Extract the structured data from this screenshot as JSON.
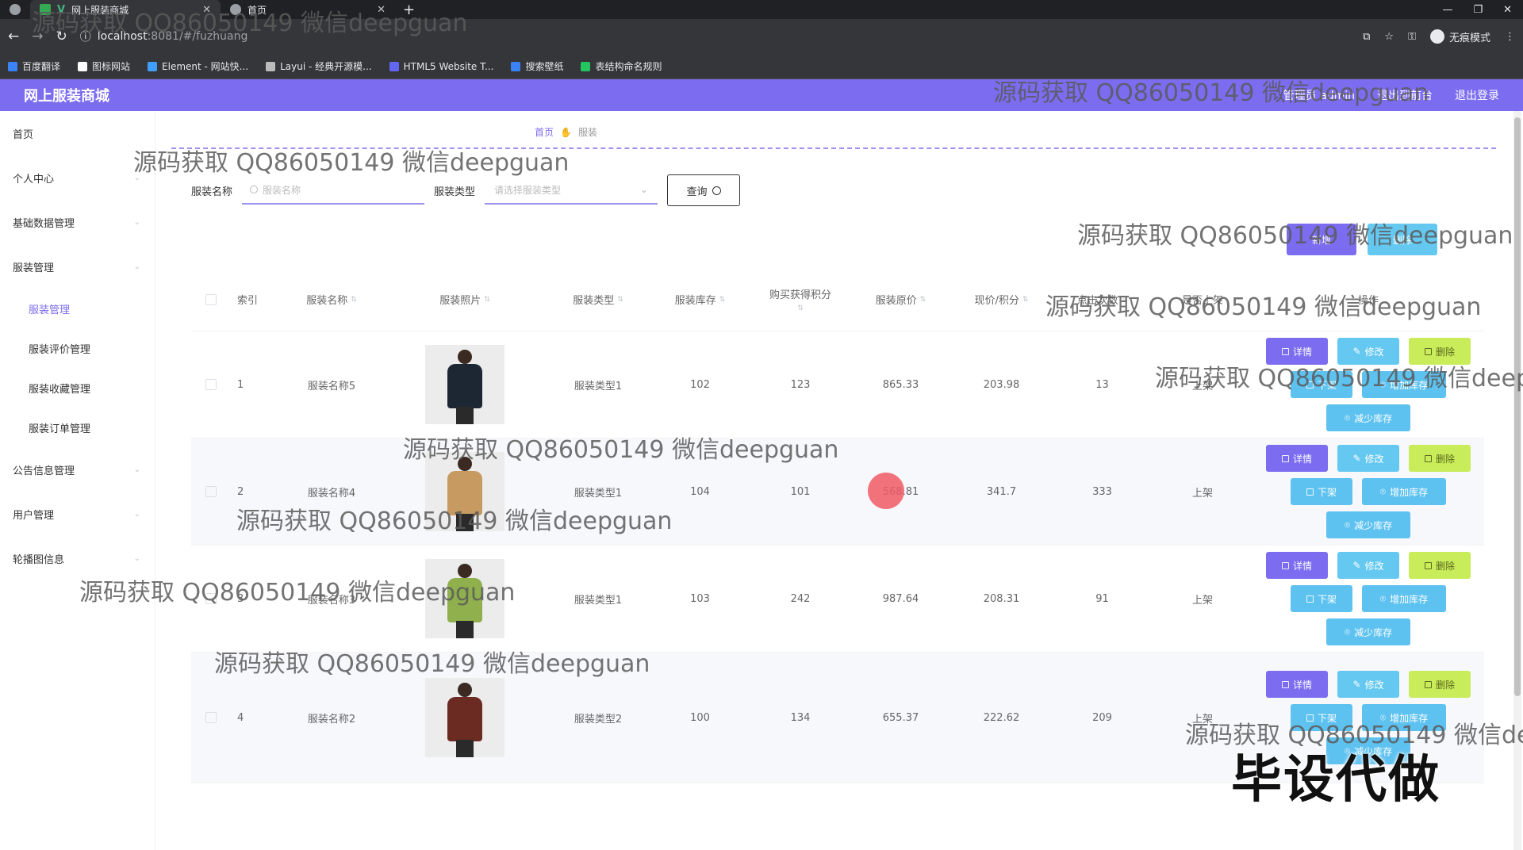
{
  "browser": {
    "tabs": [
      {
        "label": "网上服装商城",
        "active": true
      },
      {
        "label": "首页",
        "active": false
      }
    ],
    "url_host": "localhost",
    "url_rest": ":8081/#/fuzhuang",
    "incognito_label": "无痕模式",
    "bookmarks": [
      {
        "label": "百度翻译",
        "color": "#3b82f6"
      },
      {
        "label": "图标网站",
        "color": "#ffffff"
      },
      {
        "label": "Element - 网站快...",
        "color": "#409eff"
      },
      {
        "label": "Layui - 经典开源模...",
        "color": "#bbbbbb"
      },
      {
        "label": "HTML5 Website T...",
        "color": "#6366f1"
      },
      {
        "label": "搜索壁纸",
        "color": "#3b82f6"
      },
      {
        "label": "表结构命名规则",
        "color": "#22c55e"
      }
    ]
  },
  "header": {
    "title": "网上服装商城",
    "user": "管理员 admin",
    "exit_system": "退出到前台",
    "logout": "退出登录",
    "bg_color": "#7b6cf0"
  },
  "sidebar": {
    "items": [
      {
        "label": "首页",
        "expandable": false
      },
      {
        "label": "个人中心",
        "expandable": true
      },
      {
        "label": "基础数据管理",
        "expandable": true
      },
      {
        "label": "服装管理",
        "expandable": true
      }
    ],
    "sub_items": [
      {
        "label": "服装管理",
        "active": true
      },
      {
        "label": "服装评价管理",
        "active": false
      },
      {
        "label": "服装收藏管理",
        "active": false
      },
      {
        "label": "服装订单管理",
        "active": false
      }
    ],
    "items_after": [
      {
        "label": "公告信息管理",
        "expandable": true
      },
      {
        "label": "用户管理",
        "expandable": true
      },
      {
        "label": "轮播图信息",
        "expandable": true
      }
    ]
  },
  "breadcrumb": {
    "home": "首页",
    "current": "服装"
  },
  "search": {
    "name_label": "服装名称",
    "name_placeholder": "服装名称",
    "type_label": "服装类型",
    "type_placeholder": "请选择服装类型",
    "query_button": "查询"
  },
  "toolbar": {
    "add_label": "新增",
    "delete_label": "删除"
  },
  "table": {
    "columns": {
      "index": "索引",
      "name": "服装名称",
      "photo": "服装照片",
      "type": "服装类型",
      "stock": "服装库存",
      "points": "购买获得积分",
      "orig_price": "服装原价",
      "now_price": "现价/积分",
      "clicks": "点击次数",
      "status": "是否上架",
      "ops": "操作"
    },
    "rows": [
      {
        "index": "1",
        "name": "服装名称5",
        "type": "服装类型1",
        "stock": "102",
        "points": "123",
        "orig_price": "865.33",
        "now_price": "203.98",
        "clicks": "13",
        "status": "上架",
        "photo_color": "#1c2733"
      },
      {
        "index": "2",
        "name": "服装名称4",
        "type": "服装类型1",
        "stock": "104",
        "points": "101",
        "orig_price": "568.81",
        "now_price": "341.7",
        "clicks": "333",
        "status": "上架",
        "photo_color": "#c79a62"
      },
      {
        "index": "3",
        "name": "服装名称3",
        "type": "服装类型1",
        "stock": "103",
        "points": "242",
        "orig_price": "987.64",
        "now_price": "208.31",
        "clicks": "91",
        "status": "上架",
        "photo_color": "#8fb04c"
      },
      {
        "index": "4",
        "name": "服装名称2",
        "type": "服装类型2",
        "stock": "100",
        "points": "134",
        "orig_price": "655.37",
        "now_price": "222.62",
        "clicks": "209",
        "status": "上架",
        "photo_color": "#6b2a22"
      }
    ],
    "op_labels": {
      "detail": "详情",
      "edit": "修改",
      "delete": "删除",
      "off_shelf": "下架",
      "add_stock": "增加库存",
      "reduce_stock": "减少库存"
    }
  },
  "overlay": {
    "watermark": "源码获取 QQ86050149 微信deepguan",
    "big_stamp": "毕设代做"
  }
}
